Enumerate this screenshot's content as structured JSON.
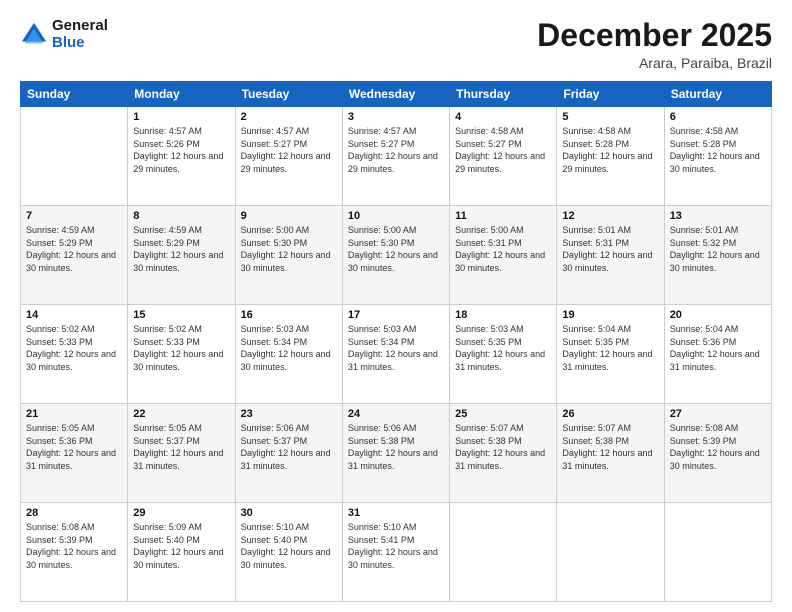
{
  "header": {
    "logo_line1": "General",
    "logo_line2": "Blue",
    "month_title": "December 2025",
    "location": "Arara, Paraiba, Brazil"
  },
  "days_of_week": [
    "Sunday",
    "Monday",
    "Tuesday",
    "Wednesday",
    "Thursday",
    "Friday",
    "Saturday"
  ],
  "weeks": [
    [
      {
        "day": "",
        "sunrise": "",
        "sunset": "",
        "daylight": ""
      },
      {
        "day": "1",
        "sunrise": "4:57 AM",
        "sunset": "5:26 PM",
        "daylight": "12 hours and 29 minutes."
      },
      {
        "day": "2",
        "sunrise": "4:57 AM",
        "sunset": "5:27 PM",
        "daylight": "12 hours and 29 minutes."
      },
      {
        "day": "3",
        "sunrise": "4:57 AM",
        "sunset": "5:27 PM",
        "daylight": "12 hours and 29 minutes."
      },
      {
        "day": "4",
        "sunrise": "4:58 AM",
        "sunset": "5:27 PM",
        "daylight": "12 hours and 29 minutes."
      },
      {
        "day": "5",
        "sunrise": "4:58 AM",
        "sunset": "5:28 PM",
        "daylight": "12 hours and 29 minutes."
      },
      {
        "day": "6",
        "sunrise": "4:58 AM",
        "sunset": "5:28 PM",
        "daylight": "12 hours and 30 minutes."
      }
    ],
    [
      {
        "day": "7",
        "sunrise": "4:59 AM",
        "sunset": "5:29 PM",
        "daylight": "12 hours and 30 minutes."
      },
      {
        "day": "8",
        "sunrise": "4:59 AM",
        "sunset": "5:29 PM",
        "daylight": "12 hours and 30 minutes."
      },
      {
        "day": "9",
        "sunrise": "5:00 AM",
        "sunset": "5:30 PM",
        "daylight": "12 hours and 30 minutes."
      },
      {
        "day": "10",
        "sunrise": "5:00 AM",
        "sunset": "5:30 PM",
        "daylight": "12 hours and 30 minutes."
      },
      {
        "day": "11",
        "sunrise": "5:00 AM",
        "sunset": "5:31 PM",
        "daylight": "12 hours and 30 minutes."
      },
      {
        "day": "12",
        "sunrise": "5:01 AM",
        "sunset": "5:31 PM",
        "daylight": "12 hours and 30 minutes."
      },
      {
        "day": "13",
        "sunrise": "5:01 AM",
        "sunset": "5:32 PM",
        "daylight": "12 hours and 30 minutes."
      }
    ],
    [
      {
        "day": "14",
        "sunrise": "5:02 AM",
        "sunset": "5:33 PM",
        "daylight": "12 hours and 30 minutes."
      },
      {
        "day": "15",
        "sunrise": "5:02 AM",
        "sunset": "5:33 PM",
        "daylight": "12 hours and 30 minutes."
      },
      {
        "day": "16",
        "sunrise": "5:03 AM",
        "sunset": "5:34 PM",
        "daylight": "12 hours and 30 minutes."
      },
      {
        "day": "17",
        "sunrise": "5:03 AM",
        "sunset": "5:34 PM",
        "daylight": "12 hours and 31 minutes."
      },
      {
        "day": "18",
        "sunrise": "5:03 AM",
        "sunset": "5:35 PM",
        "daylight": "12 hours and 31 minutes."
      },
      {
        "day": "19",
        "sunrise": "5:04 AM",
        "sunset": "5:35 PM",
        "daylight": "12 hours and 31 minutes."
      },
      {
        "day": "20",
        "sunrise": "5:04 AM",
        "sunset": "5:36 PM",
        "daylight": "12 hours and 31 minutes."
      }
    ],
    [
      {
        "day": "21",
        "sunrise": "5:05 AM",
        "sunset": "5:36 PM",
        "daylight": "12 hours and 31 minutes."
      },
      {
        "day": "22",
        "sunrise": "5:05 AM",
        "sunset": "5:37 PM",
        "daylight": "12 hours and 31 minutes."
      },
      {
        "day": "23",
        "sunrise": "5:06 AM",
        "sunset": "5:37 PM",
        "daylight": "12 hours and 31 minutes."
      },
      {
        "day": "24",
        "sunrise": "5:06 AM",
        "sunset": "5:38 PM",
        "daylight": "12 hours and 31 minutes."
      },
      {
        "day": "25",
        "sunrise": "5:07 AM",
        "sunset": "5:38 PM",
        "daylight": "12 hours and 31 minutes."
      },
      {
        "day": "26",
        "sunrise": "5:07 AM",
        "sunset": "5:38 PM",
        "daylight": "12 hours and 31 minutes."
      },
      {
        "day": "27",
        "sunrise": "5:08 AM",
        "sunset": "5:39 PM",
        "daylight": "12 hours and 30 minutes."
      }
    ],
    [
      {
        "day": "28",
        "sunrise": "5:08 AM",
        "sunset": "5:39 PM",
        "daylight": "12 hours and 30 minutes."
      },
      {
        "day": "29",
        "sunrise": "5:09 AM",
        "sunset": "5:40 PM",
        "daylight": "12 hours and 30 minutes."
      },
      {
        "day": "30",
        "sunrise": "5:10 AM",
        "sunset": "5:40 PM",
        "daylight": "12 hours and 30 minutes."
      },
      {
        "day": "31",
        "sunrise": "5:10 AM",
        "sunset": "5:41 PM",
        "daylight": "12 hours and 30 minutes."
      },
      {
        "day": "",
        "sunrise": "",
        "sunset": "",
        "daylight": ""
      },
      {
        "day": "",
        "sunrise": "",
        "sunset": "",
        "daylight": ""
      },
      {
        "day": "",
        "sunrise": "",
        "sunset": "",
        "daylight": ""
      }
    ]
  ]
}
